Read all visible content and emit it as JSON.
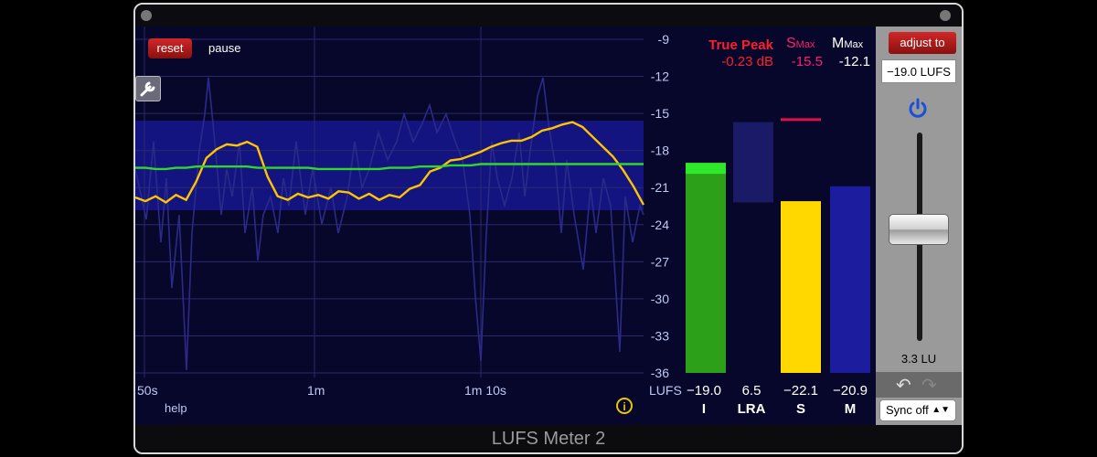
{
  "window": {
    "title": "LUFS Meter 2"
  },
  "controls": {
    "reset_label": "reset",
    "pause_label": "pause",
    "help_label": "help",
    "info_label": "i"
  },
  "y_axis": {
    "ticks": [
      "-9",
      "-12",
      "-15",
      "-18",
      "-21",
      "-24",
      "-27",
      "-30",
      "-33",
      "-36"
    ],
    "unit": "LUFS",
    "min": -36,
    "max": -9
  },
  "x_axis": {
    "ticks": [
      "50s",
      "1m",
      "1m 10s"
    ]
  },
  "header": {
    "true_peak_label": "True Peak",
    "true_peak_value": "-0.23 dB",
    "smax_label": "S",
    "smax_sub": "Max",
    "smax_value": "-15.5",
    "mmax_label": "M",
    "mmax_sub": "Max",
    "mmax_value": "-12.1"
  },
  "meters": [
    {
      "id": "integrated",
      "value": "−19.0",
      "label": "I",
      "num": -19.0,
      "color": "#2ca019"
    },
    {
      "id": "lra",
      "value": "6.5",
      "label": "LRA",
      "num": 6.5,
      "range_low": -22.2,
      "range_high": -15.7,
      "color": "#1a1a66"
    },
    {
      "id": "short-term",
      "value": "−22.1",
      "label": "S",
      "num": -22.1,
      "max": -15.5,
      "color": "#ffd800"
    },
    {
      "id": "momentary",
      "value": "−20.9",
      "label": "M",
      "num": -20.9,
      "color": "#1c1c9e"
    }
  ],
  "side": {
    "adjust_label": "adjust to",
    "target_value": "−19.0 LUFS",
    "power_icon": "power-icon",
    "lu_value": "3.3 LU",
    "undo_icon": "undo-icon",
    "redo_icon": "redo-icon",
    "sync_value": "Sync off"
  },
  "colors": {
    "background": "#07072c",
    "integrated": "#2ca019",
    "short_term": "#ffd800",
    "warning": "#e0104a",
    "accent": "#d02828"
  },
  "chart_data": {
    "type": "line",
    "x": [
      0,
      2,
      4,
      6,
      8,
      10,
      12,
      14,
      16,
      18,
      20,
      22,
      24,
      26,
      28,
      30,
      32,
      34,
      36,
      38,
      40,
      42,
      44,
      46,
      48,
      50,
      52,
      54,
      56,
      58,
      60,
      62,
      64,
      66,
      68,
      70,
      72,
      74,
      76,
      78,
      80,
      82,
      84,
      86,
      88,
      90,
      92,
      94,
      96,
      98,
      100
    ],
    "series": [
      {
        "values": [
          -21.8,
          -22.1,
          -21.7,
          -22.2,
          -21.6,
          -22.0,
          -20.5,
          -18.6,
          -17.9,
          -17.5,
          -17.6,
          -17.3,
          -17.7,
          -20.1,
          -21.7,
          -22.0,
          -21.5,
          -21.8,
          -21.6,
          -21.9,
          -21.3,
          -21.4,
          -21.9,
          -21.5,
          -22.0,
          -21.6,
          -21.8,
          -21.1,
          -20.8,
          -19.7,
          -19.4,
          -18.8,
          -18.7,
          -18.4,
          -18.1,
          -17.7,
          -17.4,
          -17.2,
          -17.2,
          -16.9,
          -16.4,
          -16.2,
          -15.9,
          -15.7,
          -16.1,
          -16.9,
          -17.7,
          -18.5,
          -19.6,
          -20.9,
          -22.4
        ]
      },
      {
        "values": [
          -19.4,
          -19.4,
          -19.5,
          -19.5,
          -19.4,
          -19.4,
          -19.3,
          -19.3,
          -19.3,
          -19.3,
          -19.3,
          -19.3,
          -19.4,
          -19.4,
          -19.4,
          -19.4,
          -19.4,
          -19.4,
          -19.5,
          -19.5,
          -19.5,
          -19.5,
          -19.5,
          -19.5,
          -19.5,
          -19.4,
          -19.4,
          -19.4,
          -19.3,
          -19.3,
          -19.3,
          -19.2,
          -19.2,
          -19.2,
          -19.1,
          -19.1,
          -19.1,
          -19.1,
          -19.1,
          -19.1,
          -19.1,
          -19.1,
          -19.1,
          -19.1,
          -19.1,
          -19.1,
          -19.1,
          -19.1,
          -19.1,
          -19.1,
          -19.1
        ]
      }
    ],
    "xlabel": "",
    "ylabel": "LUFS",
    "ylim": [
      -36,
      -9
    ],
    "grid": true
  }
}
